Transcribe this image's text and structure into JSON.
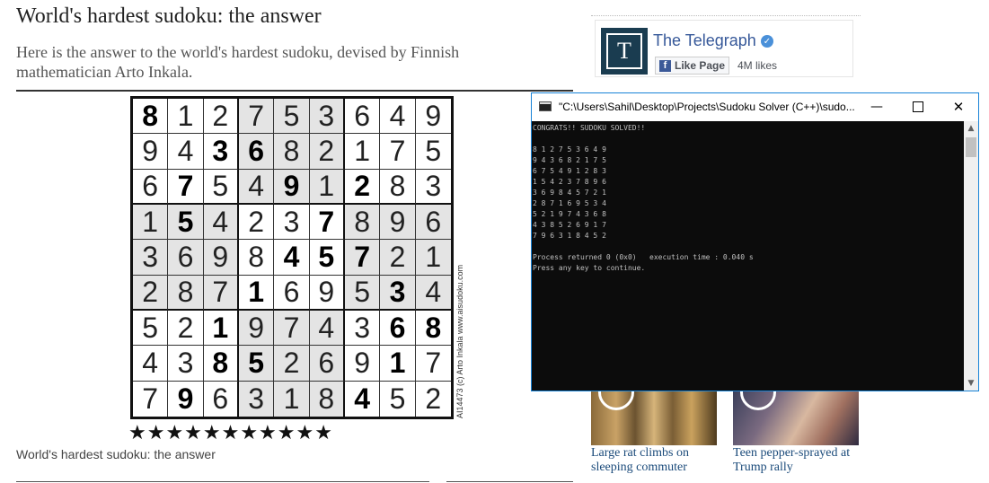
{
  "article": {
    "headline": "World's hardest sudoku: the answer",
    "standfirst": "Here is the answer to the world's hardest sudoku, devised by Finnish mathematician Arto Inkala.",
    "caption": "World's hardest sudoku: the answer",
    "credit": "AI14473 (c) Arto Inkala www.aisudoku.com",
    "stars": "★★★★★★★★★★★"
  },
  "sudoku": {
    "grid": [
      [
        8,
        1,
        2,
        7,
        5,
        3,
        6,
        4,
        9
      ],
      [
        9,
        4,
        3,
        6,
        8,
        2,
        1,
        7,
        5
      ],
      [
        6,
        7,
        5,
        4,
        9,
        1,
        2,
        8,
        3
      ],
      [
        1,
        5,
        4,
        2,
        3,
        7,
        8,
        9,
        6
      ],
      [
        3,
        6,
        9,
        8,
        4,
        5,
        7,
        2,
        1
      ],
      [
        2,
        8,
        7,
        1,
        6,
        9,
        5,
        3,
        4
      ],
      [
        5,
        2,
        1,
        9,
        7,
        4,
        3,
        6,
        8
      ],
      [
        4,
        3,
        8,
        5,
        2,
        6,
        9,
        1,
        7
      ],
      [
        7,
        9,
        6,
        3,
        1,
        8,
        4,
        5,
        2
      ]
    ],
    "givens": [
      [
        1,
        0,
        0,
        0,
        0,
        0,
        0,
        0,
        0
      ],
      [
        0,
        0,
        1,
        1,
        0,
        0,
        0,
        0,
        0
      ],
      [
        0,
        1,
        0,
        0,
        1,
        0,
        1,
        0,
        0
      ],
      [
        0,
        1,
        0,
        0,
        0,
        1,
        0,
        0,
        0
      ],
      [
        0,
        0,
        0,
        0,
        1,
        1,
        1,
        0,
        0
      ],
      [
        0,
        0,
        0,
        1,
        0,
        0,
        0,
        1,
        0
      ],
      [
        0,
        0,
        1,
        0,
        0,
        0,
        0,
        1,
        1
      ],
      [
        0,
        0,
        1,
        1,
        0,
        0,
        0,
        1,
        0
      ],
      [
        0,
        1,
        0,
        0,
        0,
        0,
        1,
        0,
        0
      ]
    ]
  },
  "facebook": {
    "page_name": "The Telegraph",
    "logo_letter": "T",
    "like_label": "Like Page",
    "likes": "4M likes"
  },
  "videos": [
    {
      "caption": "Large rat climbs on sleeping commuter"
    },
    {
      "caption": "Teen pepper-sprayed at Trump rally"
    }
  ],
  "console": {
    "title": "\"C:\\Users\\Sahil\\Desktop\\Projects\\Sudoku Solver (C++)\\sudo...",
    "lines": [
      "CONGRATS!! SUDOKU SOLVED!!",
      "",
      "8 1 2 7 5 3 6 4 9",
      "9 4 3 6 8 2 1 7 5",
      "6 7 5 4 9 1 2 8 3",
      "1 5 4 2 3 7 8 9 6",
      "3 6 9 8 4 5 7 2 1",
      "2 8 7 1 6 9 5 3 4",
      "5 2 1 9 7 4 3 6 8",
      "4 3 8 5 2 6 9 1 7",
      "7 9 6 3 1 8 4 5 2",
      "",
      "Process returned 0 (0x0)   execution time : 0.040 s",
      "Press any key to continue."
    ]
  }
}
